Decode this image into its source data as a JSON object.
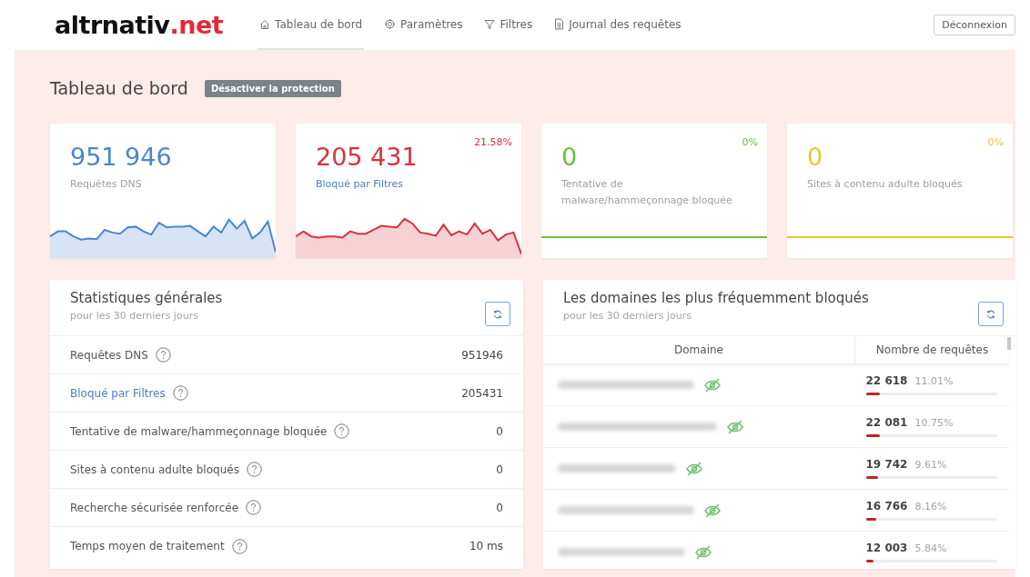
{
  "logo": {
    "text": "altrnativ",
    "accent": ".net"
  },
  "nav": [
    {
      "label": "Tableau de bord",
      "selected": true
    },
    {
      "label": "Paramètres",
      "selected": false
    },
    {
      "label": "Filtres",
      "selected": false
    },
    {
      "label": "Journal des requêtes",
      "selected": false
    }
  ],
  "logout_button": "Déconnexion",
  "page_title": "Tableau de bord",
  "protection_button": "Désactiver la protection",
  "stat_cards": [
    {
      "kind": "sparkline",
      "value": "951 946",
      "label": "Requêtes DNS",
      "color": "#4a86d2",
      "label_link": false
    },
    {
      "kind": "sparkline",
      "value": "205 431",
      "label": "Bloqué par Filtres",
      "percent": "21.58%",
      "color": "#d9323c",
      "label_link": true
    },
    {
      "kind": "line",
      "value": "0",
      "label": "Tentative de malware/hammeçonnage bloquée",
      "percent": "0%",
      "color": "#6cbf3c",
      "label_link": false
    },
    {
      "kind": "line",
      "value": "0",
      "label": "Sites à contenu adulte bloqués",
      "percent": "0%",
      "color": "#f0c331",
      "label_link": false
    }
  ],
  "general_stats": {
    "title": "Statistiques générales",
    "subtitle": "pour les 30 derniers jours",
    "rows": [
      {
        "label": "Requêtes DNS",
        "value": "951946",
        "link": false
      },
      {
        "label": "Bloqué par Filtres",
        "value": "205431",
        "link": true
      },
      {
        "label": "Tentative de malware/hammeçonnage bloquée",
        "value": "0",
        "link": false
      },
      {
        "label": "Sites à contenu adulte bloqués",
        "value": "0",
        "link": false
      },
      {
        "label": "Recherche sécurisée renforcée",
        "value": "0",
        "link": false
      },
      {
        "label": "Temps moyen de traitement",
        "value": "10 ms",
        "link": false
      }
    ]
  },
  "top_blocked": {
    "title": "Les domaines les plus fréquemment bloqués",
    "subtitle": "pour les 30 derniers jours",
    "columns": [
      "Domaine",
      "Nombre de requêtes"
    ],
    "rows": [
      {
        "count": "22 618",
        "percent": "11.01%",
        "level": 0.1101
      },
      {
        "count": "22 081",
        "percent": "10.75%",
        "level": 0.1075
      },
      {
        "count": "19 742",
        "percent": "9.61%",
        "level": 0.0961
      },
      {
        "count": "16 766",
        "percent": "8.16%",
        "level": 0.0816
      },
      {
        "count": "12 003",
        "percent": "5.84%",
        "level": 0.0584
      }
    ]
  }
}
